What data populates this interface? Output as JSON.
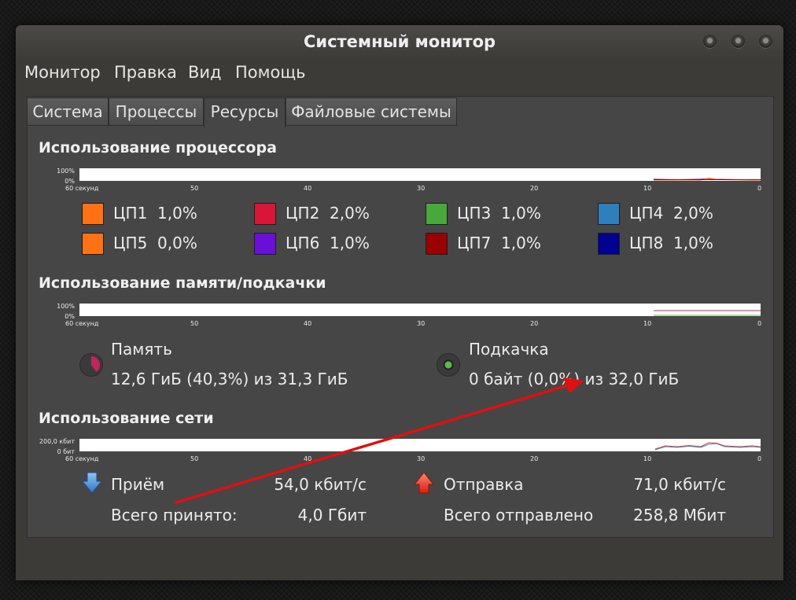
{
  "window": {
    "title": "Системный монитор"
  },
  "menu": [
    "Монитор",
    "Правка",
    "Вид",
    "Помощь"
  ],
  "tabs": [
    "Система",
    "Процессы",
    "Ресурсы",
    "Файловые системы"
  ],
  "active_tab": "Ресурсы",
  "cpu": {
    "title": "Использование процессора",
    "y_labels": [
      "100%",
      "0%"
    ],
    "x_labels": [
      "60 секунд",
      "50",
      "40",
      "30",
      "20",
      "10",
      "0"
    ],
    "items": [
      {
        "label": "ЦП1",
        "value": "1,0%",
        "color": "#ff7214"
      },
      {
        "label": "ЦП2",
        "value": "2,0%",
        "color": "#d8163a"
      },
      {
        "label": "ЦП3",
        "value": "1,0%",
        "color": "#48a83c"
      },
      {
        "label": "ЦП4",
        "value": "2,0%",
        "color": "#2f7fbd"
      },
      {
        "label": "ЦП5",
        "value": "0,0%",
        "color": "#ff7214"
      },
      {
        "label": "ЦП6",
        "value": "1,0%",
        "color": "#6a0fd6"
      },
      {
        "label": "ЦП7",
        "value": "1,0%",
        "color": "#9b0000"
      },
      {
        "label": "ЦП8",
        "value": "1,0%",
        "color": "#000092"
      }
    ]
  },
  "memory": {
    "title": "Использование памяти/подкачки",
    "y_labels": [
      "100%",
      "0%"
    ],
    "x_labels": [
      "60 секунд",
      "50",
      "40",
      "30",
      "20",
      "10",
      "0"
    ],
    "ram": {
      "label": "Память",
      "value": "12,6 ГиБ (40,3%) из 31,3 ГиБ",
      "color": "#c0255e",
      "fraction": 0.403
    },
    "swap": {
      "label": "Подкачка",
      "value": "0 байт (0,0%) из 32,0 ГиБ",
      "color": "#5cb84a",
      "fraction": 0.0
    }
  },
  "network": {
    "title": "Использование сети",
    "y_labels": [
      "200,0 кбит",
      "0 бит"
    ],
    "x_labels": [
      "60 секунд",
      "50",
      "40",
      "30",
      "20",
      "10",
      "0"
    ],
    "receive": {
      "label": "Приём",
      "rate": "54,0 кбит/с",
      "total_label": "Всего принято:",
      "total": "4,0 Гбит",
      "icon": "arrow-down-icon",
      "color": "#3d8fd8"
    },
    "send": {
      "label": "Отправка",
      "rate": "71,0 кбит/с",
      "total_label": "Всего отправлено",
      "total": "258,8 Мбит",
      "icon": "arrow-up-icon",
      "color": "#e53a1f"
    }
  },
  "annotation": {
    "color": "#e01010"
  }
}
